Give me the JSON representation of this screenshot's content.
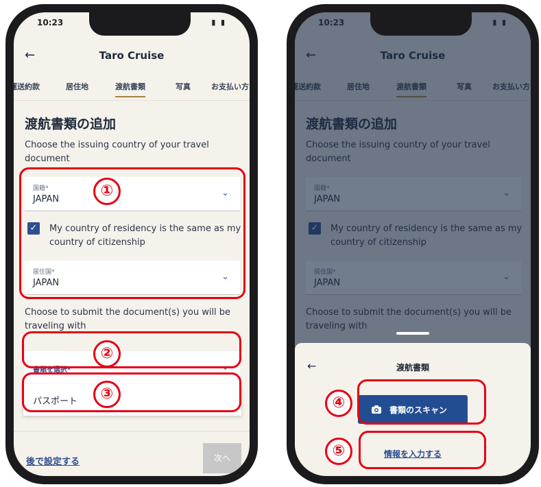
{
  "status_bar": {
    "time": "10:23",
    "icons": "▮ ▮"
  },
  "app": {
    "title": "Taro Cruise",
    "back_icon": "arrow-left-icon"
  },
  "tabs": [
    {
      "label": "運送約款"
    },
    {
      "label": "居住地"
    },
    {
      "label": "渡航書類",
      "active": true
    },
    {
      "label": "写真"
    },
    {
      "label": "お支払い方"
    }
  ],
  "form": {
    "heading": "渡航書類の追加",
    "issuing_prompt": "Choose the issuing country of your travel document",
    "citizenship": {
      "label": "国籍*",
      "value": "JAPAN"
    },
    "same_residency": {
      "checked": true,
      "label": "My country of residency is the same as my country of citizenship"
    },
    "residency": {
      "label": "居住国*",
      "value": "JAPAN"
    },
    "submit_prompt": "Choose to submit the document(s) you will be traveling with",
    "document_select": {
      "placeholder": "書類を選択*"
    },
    "option_passport": "パスポート"
  },
  "footer": {
    "later": "後で設定する",
    "next": "次へ"
  },
  "sheet": {
    "title": "渡航書類",
    "scan_button": "書類のスキャン",
    "manual_link": "情報を入力する",
    "camera_icon": "camera-icon"
  },
  "callouts": {
    "n1": "①",
    "n2": "②",
    "n3": "③",
    "n4": "④",
    "n5": "⑤"
  },
  "colors": {
    "accent": "#224d93",
    "tab_underline": "#a6813e",
    "callout": "#e60012",
    "background": "#f5f2ec"
  }
}
